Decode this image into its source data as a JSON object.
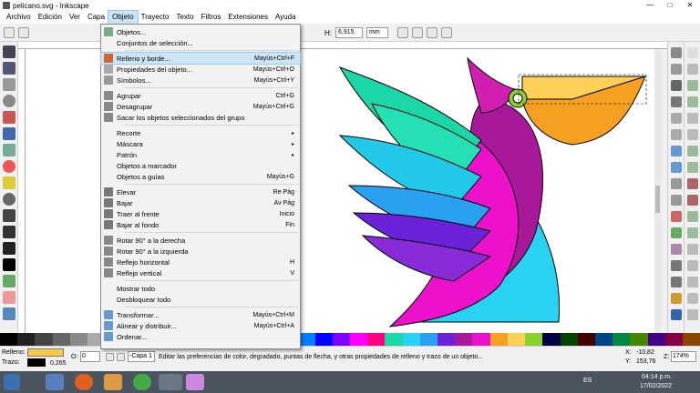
{
  "window": {
    "title": "pelicano.svg - Inkscape",
    "minimize": "—",
    "maximize": "□",
    "close": "✕"
  },
  "menubar": [
    "Archivo",
    "Edición",
    "Ver",
    "Capa",
    "Objeto",
    "Trayecto",
    "Texto",
    "Filtros",
    "Extensiones",
    "Ayuda"
  ],
  "toolbar": {
    "h_label": "H:",
    "h_value": "6,915",
    "unit": "mm"
  },
  "menu": {
    "items": [
      {
        "label": "Objetos...",
        "shortcut": ""
      },
      {
        "label": "Conjuntos de selección...",
        "shortcut": ""
      },
      {
        "label": "Relleno y borde...",
        "shortcut": "Mayús+Ctrl+F"
      },
      {
        "label": "Propiedades del objeto...",
        "shortcut": "Mayús+Ctrl+O"
      },
      {
        "label": "Símbolos...",
        "shortcut": "Mayús+Ctrl+Y"
      },
      {
        "label": "Agrupar",
        "shortcut": "Ctrl+G"
      },
      {
        "label": "Desagrupar",
        "shortcut": "Mayús+Ctrl+G"
      },
      {
        "label": "Sacar los objetos seleccionados del grupo",
        "shortcut": ""
      },
      {
        "label": "Recorte",
        "shortcut": "▸"
      },
      {
        "label": "Máscara",
        "shortcut": "▸"
      },
      {
        "label": "Patrón",
        "shortcut": "▸"
      },
      {
        "label": "Objetos a marcador",
        "shortcut": ""
      },
      {
        "label": "Objetos a guías",
        "shortcut": "Mayús+G"
      },
      {
        "label": "Elevar",
        "shortcut": "Re Pág"
      },
      {
        "label": "Bajar",
        "shortcut": "Av Pág"
      },
      {
        "label": "Traer al frente",
        "shortcut": "Inicio"
      },
      {
        "label": "Bajar al fondo",
        "shortcut": "Fin"
      },
      {
        "label": "Rotar 90° a la derecha",
        "shortcut": ""
      },
      {
        "label": "Rotar 90° a la izquierda",
        "shortcut": ""
      },
      {
        "label": "Reflejo horizontal",
        "shortcut": "H"
      },
      {
        "label": "Reflejo vertical",
        "shortcut": "V"
      },
      {
        "label": "Mostrar todo",
        "shortcut": ""
      },
      {
        "label": "Desbloquear todo",
        "shortcut": ""
      },
      {
        "label": "Transformar...",
        "shortcut": "Mayús+Ctrl+M"
      },
      {
        "label": "Alinear y distribuir...",
        "shortcut": "Mayús+Ctrl+A"
      },
      {
        "label": "Ordenar...",
        "shortcut": ""
      }
    ]
  },
  "status": {
    "fill_label": "Relleno:",
    "stroke_label": "Trazo:",
    "stroke_width": "0,265",
    "opacity_label": "O:",
    "opacity_value": "0",
    "layer": "-Capa 1",
    "message": "Editar las preferencias de color, degradado, puntas de flecha, y otras propiedades de relleno y trazo de un objeto...",
    "x_label": "X:",
    "x_value": "-10,82",
    "y_label": "Y:",
    "y_value": "153,76",
    "z_label": "Z:",
    "zoom": "174%"
  },
  "taskbar": {
    "lang": "ES",
    "time": "04:14 p.m.",
    "date": "17/02/2022"
  },
  "colors": {
    "menu_highlight": "#cce4f7",
    "fill_swatch": "#f7c948"
  }
}
